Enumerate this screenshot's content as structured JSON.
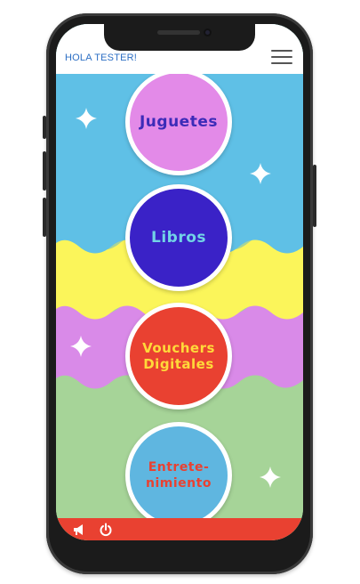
{
  "header": {
    "greeting": "HOLA TESTER!"
  },
  "categories": [
    {
      "label": "Juguetes"
    },
    {
      "label": "Libros"
    },
    {
      "label": "Vouchers Digitales"
    },
    {
      "label": "Entrete-nimiento"
    }
  ],
  "footer": {
    "icons": [
      "megaphone-icon",
      "power-icon"
    ]
  },
  "colors": {
    "sky": "#5fc0e6",
    "yellow": "#fbf55a",
    "pink": "#d98ae8",
    "green": "#a6d498",
    "footer": "#e94131",
    "greeting": "#2d6fc4"
  }
}
